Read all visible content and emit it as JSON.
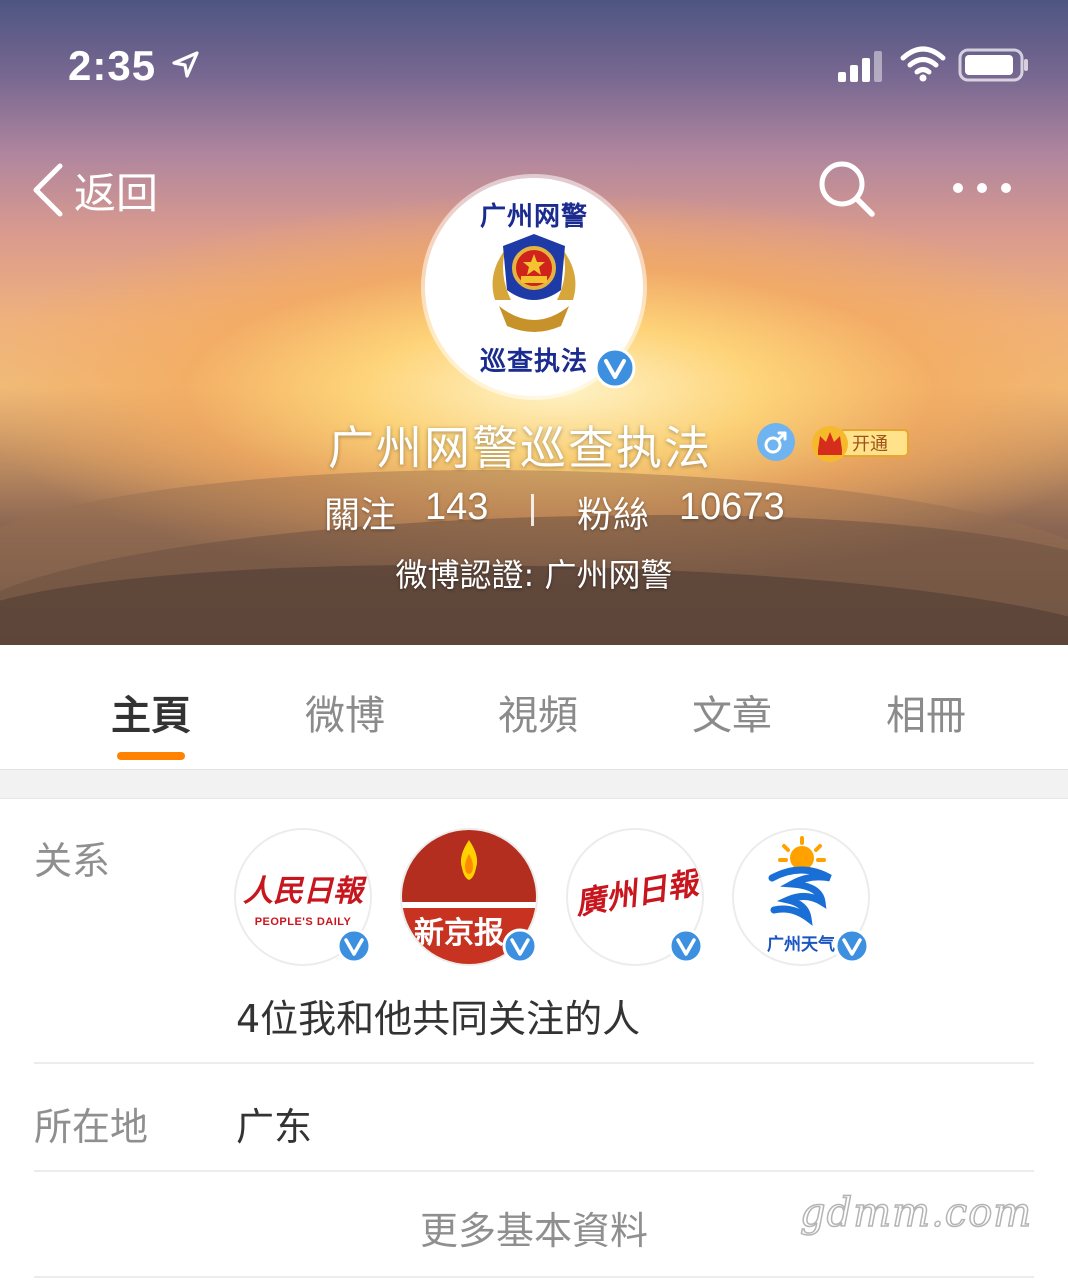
{
  "status_bar": {
    "time": "2:35",
    "icons": [
      "location-arrow-icon",
      "cellular-signal-icon",
      "wifi-icon",
      "battery-icon"
    ]
  },
  "nav": {
    "back_label": "返回",
    "icons": [
      "back-chevron-icon",
      "search-icon",
      "more-dots-icon"
    ]
  },
  "profile": {
    "avatar_top_text": "广州网警",
    "avatar_bottom_text": "巡查执法",
    "name": "广州网警巡查执法",
    "gender": "male",
    "vip_label": "开通",
    "follow_label": "關注",
    "follow_count": "143",
    "fans_label": "粉絲",
    "fans_count": "10673",
    "verification": "微博認證: 广州网警"
  },
  "tabs": [
    {
      "label": "主頁",
      "active": true
    },
    {
      "label": "微博",
      "active": false
    },
    {
      "label": "視頻",
      "active": false
    },
    {
      "label": "文章",
      "active": false
    },
    {
      "label": "相冊",
      "active": false
    }
  ],
  "info": {
    "relation_label": "关系",
    "common_accounts": [
      {
        "logo_title": "人民日報",
        "logo_sub": "PEOPLE'S DAILY"
      },
      {
        "logo_title": "新京报"
      },
      {
        "logo_title": "廣州日報"
      },
      {
        "logo_title": "广州天气"
      }
    ],
    "common_follow_text": "4位我和他共同关注的人",
    "location_label": "所在地",
    "location_value": "广东",
    "more_label": "更多基本資料"
  },
  "watermark": "gdmm.com",
  "colors": {
    "accent": "#ff8200",
    "verified": "#3d8fe0",
    "tab_inactive": "#8b8b8b",
    "text": "#333333"
  }
}
